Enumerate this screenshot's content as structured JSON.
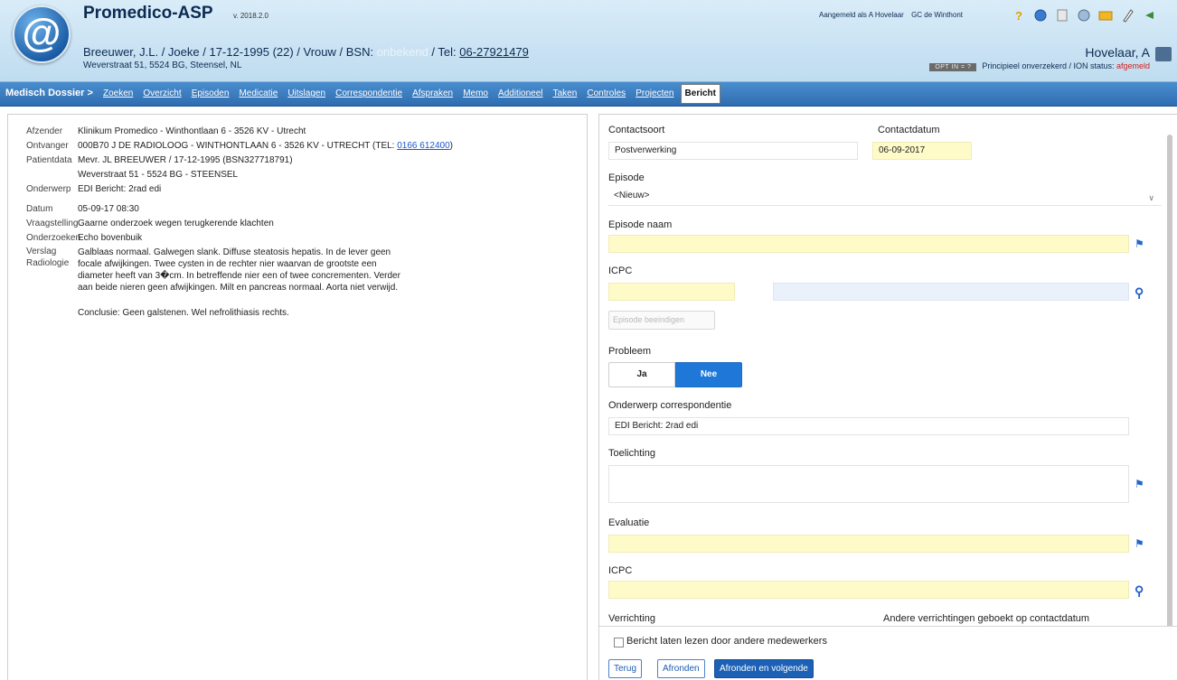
{
  "app": {
    "name": "Promedico-ASP",
    "version": "v. 2018.2.0"
  },
  "patient": {
    "line_prefix": "Breeuwer, J.L. / Joeke / 17-12-1995 (22) / Vrouw / BSN: ",
    "bsn_value": "onbekend",
    "tel_label": " / Tel: ",
    "tel_value": "06-27921479",
    "address": "Weverstraat 51, 5524 BG, Steensel, NL"
  },
  "session": {
    "logged_in": "Aangemeld als A Hovelaar",
    "practice": "GC de Winthont",
    "user_name": "Hovelaar, A",
    "optin_badge": "OPT IN = ?",
    "status_text": "Principieel onverzekerd / ION status: ",
    "ion_status": "afgemeld"
  },
  "header_icons": [
    "help-icon",
    "globe-icon",
    "document-icon",
    "settings-icon",
    "folder-icon",
    "pen-icon",
    "back-icon"
  ],
  "nav": {
    "items": [
      "Medisch Dossier >",
      "Zoeken",
      "Overzicht",
      "Episoden",
      "Medicatie",
      "Uitslagen",
      "Correspondentie",
      "Afspraken",
      "Memo",
      "Additioneel",
      "Taken",
      "Controles",
      "Projecten",
      "Bericht"
    ],
    "active": "Bericht"
  },
  "message": {
    "fields": [
      {
        "label": "Afzender",
        "value": "Klinikum Promedico - Winthontlaan 6 - 3526 KV - Utrecht"
      },
      {
        "label": "Ontvanger",
        "value": "000B70 J DE RADIOLOOG - WINTHONTLAAN 6 - 3526 KV - UTRECHT (TEL: ",
        "link": "0166 612400",
        "suffix": ")"
      },
      {
        "label": "Patientdata",
        "value": "Mevr. JL BREEUWER / 17-12-1995 (BSN327718791)"
      },
      {
        "label": "",
        "value": "Weverstraat 51 - 5524 BG - STEENSEL"
      },
      {
        "label": "Onderwerp",
        "value": "EDI Bericht: 2rad edi"
      }
    ],
    "datum_label": "Datum",
    "datum_value": "05-09-17 08:30",
    "vraag_label": "Vraagstelling",
    "vraag_value": "Gaarne onderzoek wegen terugkerende klachten",
    "onderzoek_label": "Onderzoeken",
    "onderzoek_value": "Echo bovenbuik",
    "verslag_label_1": "Verslag",
    "verslag_label_2": "Radiologie",
    "verslag_text": "Galblaas normaal. Galwegen slank. Diffuse steatosis hepatis. In de lever geen focale afwijkingen. Twee cysten in de rechter nier waarvan de grootste een diameter heeft van 3�cm. In betreffende nier een of twee concrementen. Verder aan beide nieren geen afwijkingen. Milt en pancreas normaal. Aorta niet verwijd.",
    "conclusie": "Conclusie: Geen galstenen. Wel nefrolithiasis rechts."
  },
  "form": {
    "contactsoort_label": "Contactsoort",
    "contactsoort_value": "Postverwerking",
    "contactdatum_label": "Contactdatum",
    "contactdatum_value": "06-09-2017",
    "episode_label": "Episode",
    "episode_value": "<Nieuw>",
    "episode_naam_label": "Episode naam",
    "icpc_label": "ICPC",
    "episode_button": "Episode beeindigen",
    "probleem_label": "Probleem",
    "ja_label": "Ja",
    "nee_label": "Nee",
    "onderwerp_label": "Onderwerp correspondentie",
    "onderwerp_value": "EDI Bericht: 2rad edi",
    "toelichting_label": "Toelichting",
    "evaluatie_label": "Evaluatie",
    "icpc2_label": "ICPC",
    "verrichting_label": "Verrichting",
    "andere_label": "Andere verrichtingen geboekt op contactdatum",
    "checkbox_label": "Bericht laten lezen door andere medewerkers",
    "terug_label": "Terug",
    "afronden_label": "Afronden",
    "afronden_volgende_label": "Afronden en volgende"
  }
}
